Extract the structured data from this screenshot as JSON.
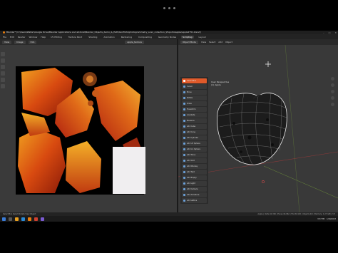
{
  "window": {
    "title": "Blender* [C:\\Users\\Walter\\Google Drive\\Blender Applications and addons\\Blender_Objects_demo_&_Path\\Gonflicts\\photogrammetry_scan_collection_\\Exports\\apple\\apple2751.blend]",
    "controls": [
      "–",
      "□",
      "✕"
    ]
  },
  "menubar": {
    "menus": [
      "File",
      "Edit",
      "Render",
      "Window",
      "Help"
    ],
    "workspaces": [
      {
        "label": "UV Editing",
        "active": false
      },
      {
        "label": "Texture Paint",
        "active": false
      },
      {
        "label": "Shading",
        "active": false
      },
      {
        "label": "Animation",
        "active": false
      },
      {
        "label": "Rendering",
        "active": false
      },
      {
        "label": "Compositing",
        "active": false
      },
      {
        "label": "Geometry Nodes",
        "active": false
      },
      {
        "label": "Scripting",
        "active": true
      },
      {
        "label": "Layout",
        "active": false
      }
    ]
  },
  "uv_editor": {
    "header": [
      "View",
      "Image",
      "UVs"
    ],
    "image_name": "apple_texture"
  },
  "viewport": {
    "header": [
      "Object Mode",
      "View",
      "Select",
      "Add",
      "Object"
    ],
    "object_info": [
      "User Perspective",
      "(1) Apple"
    ]
  },
  "toolbar": {
    "items": [
      {
        "label": "Select Box",
        "active": true
      },
      {
        "label": "Cursor",
        "active": false
      },
      {
        "label": "Move",
        "active": false
      },
      {
        "label": "Rotate",
        "active": false
      },
      {
        "label": "Scale",
        "active": false
      },
      {
        "label": "Transform",
        "active": false
      },
      {
        "label": "Annotate",
        "active": false
      },
      {
        "label": "Measure",
        "active": false
      },
      {
        "label": "Add Cube",
        "active": false
      },
      {
        "label": "Add Cone",
        "active": false
      },
      {
        "label": "Add Cylinder",
        "active": false
      },
      {
        "label": "Add UV Sphere",
        "active": false
      },
      {
        "label": "Add Ico Sphere",
        "active": false
      },
      {
        "label": "Add Torus",
        "active": false
      },
      {
        "label": "Add Grid",
        "active": false
      },
      {
        "label": "Add Monkey",
        "active": false
      },
      {
        "label": "Add Text",
        "active": false
      },
      {
        "label": "Add Empty",
        "active": false
      },
      {
        "label": "Add Light",
        "active": false
      },
      {
        "label": "Add Camera",
        "active": false
      },
      {
        "label": "Add Armature",
        "active": false
      },
      {
        "label": "Add Lattice",
        "active": false
      }
    ]
  },
  "statusbar": {
    "left": "Select   Box Select   Rotate View   Object",
    "right": "Apple | Verts:41,326 | Faces:40,962 | Tris:81,920 | Objects:0/1 | Memory: 1.27 GiB | 3.3"
  },
  "taskbar": {
    "time": "3:57 PM",
    "date": "1/16/2023"
  },
  "colors": {
    "accent": "#e05a2a",
    "panel": "#303030",
    "viewport_bg": "#393939"
  }
}
